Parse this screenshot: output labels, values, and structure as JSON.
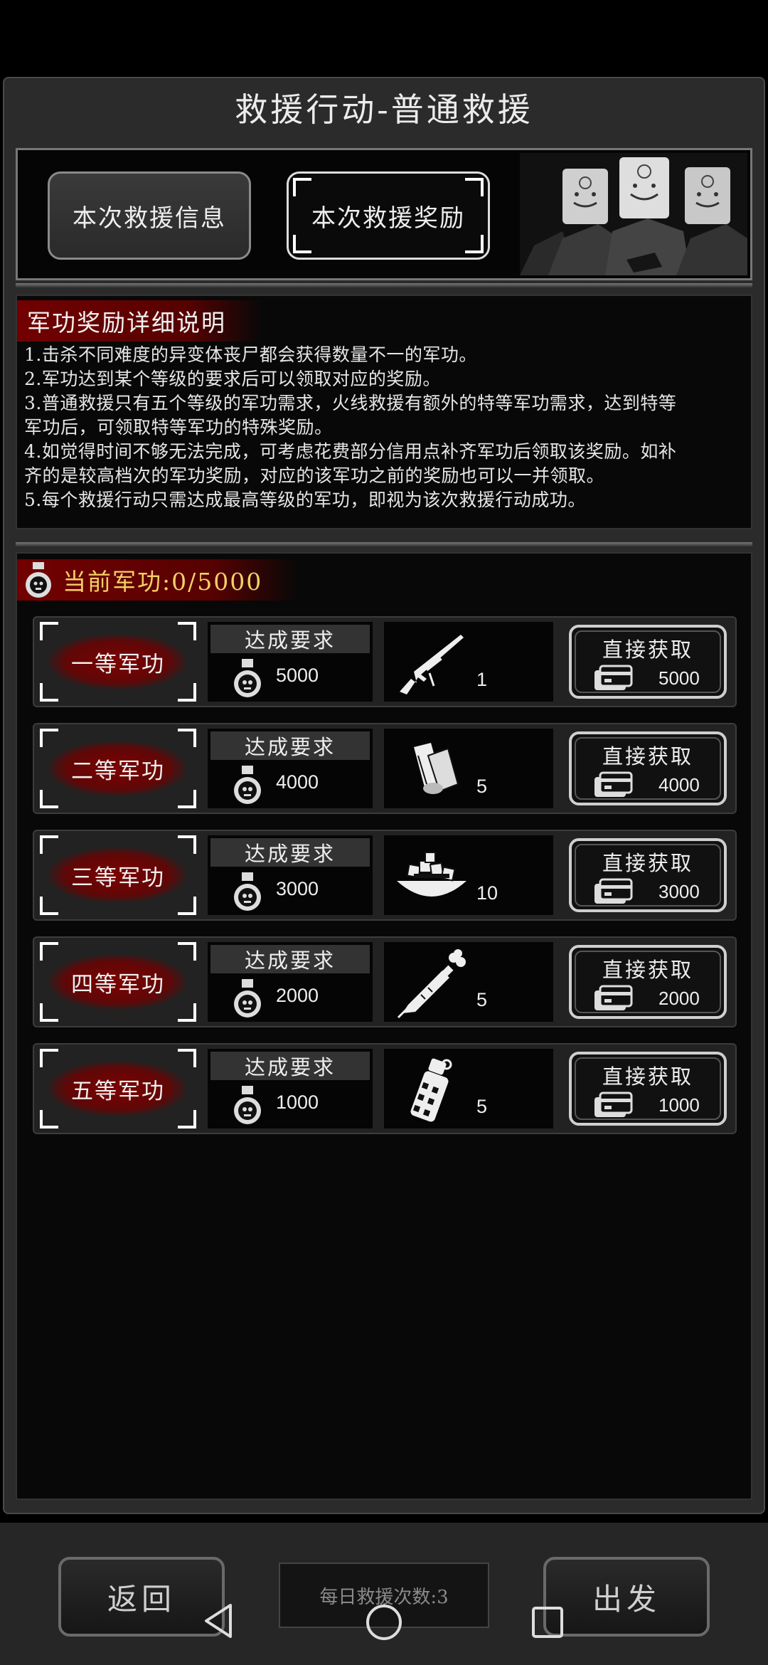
{
  "header": {
    "title": "救援行动-普通救援"
  },
  "tabs": [
    {
      "label": "本次救援信息",
      "active": false
    },
    {
      "label": "本次救援奖励",
      "active": true
    }
  ],
  "description": {
    "title": "军功奖励详细说明",
    "lines": [
      "1.击杀不同难度的异变体丧尸都会获得数量不一的军功。",
      "2.军功达到某个等级的要求后可以领取对应的奖励。",
      "3.普通救援只有五个等级的军功需求，火线救援有额外的特等军功需求，达到特等",
      "军功后，可领取特等军功的特殊奖励。",
      "4.如觉得时间不够无法完成，可考虑花费部分信用点补齐军功后领取该奖励。如补",
      "齐的是较高档次的军功奖励，对应的该军功之前的奖励也可以一并领取。",
      "5.每个救援行动只需达成最高等级的军功，即视为该次救援行动成功。"
    ]
  },
  "merit": {
    "label": "当前军功:0/5000"
  },
  "rewards": {
    "req_label": "达成要求",
    "btn_label": "直接获取",
    "rows": [
      {
        "rank": "一等军功",
        "requirement": "5000",
        "item_icon": "sniper-rifle-icon",
        "item_count": "1",
        "cost": "5000"
      },
      {
        "rank": "二等军功",
        "requirement": "4000",
        "item_icon": "scroll-icon",
        "item_count": "5",
        "cost": "4000"
      },
      {
        "rank": "三等军功",
        "requirement": "3000",
        "item_icon": "food-bowl-icon",
        "item_count": "10",
        "cost": "3000"
      },
      {
        "rank": "四等军功",
        "requirement": "2000",
        "item_icon": "syringe-icon",
        "item_count": "5",
        "cost": "2000"
      },
      {
        "rank": "五等军功",
        "requirement": "1000",
        "item_icon": "grenade-icon",
        "item_count": "5",
        "cost": "1000"
      }
    ]
  },
  "footer": {
    "back_label": "返回",
    "daily_label": "每日救援次数:3",
    "depart_label": "出发"
  },
  "colors": {
    "accent_red": "#7a0000",
    "merit_gold": "#f5d067"
  }
}
